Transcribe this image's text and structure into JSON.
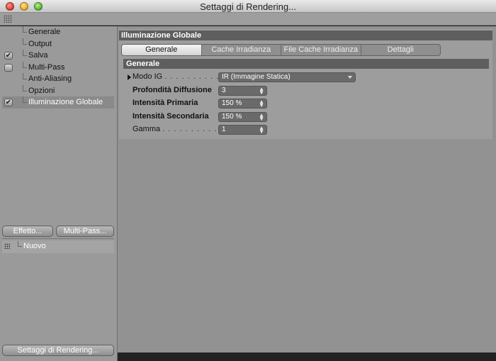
{
  "window": {
    "title": "Settaggi di Rendering..."
  },
  "sidebar": {
    "items": [
      {
        "label": "Generale",
        "checkbox": false,
        "checked": false
      },
      {
        "label": "Output",
        "checkbox": false,
        "checked": false
      },
      {
        "label": "Salva",
        "checkbox": true,
        "checked": true
      },
      {
        "label": "Multi-Pass",
        "checkbox": true,
        "checked": false
      },
      {
        "label": "Anti-Aliasing",
        "checkbox": false,
        "checked": false
      },
      {
        "label": "Opzioni",
        "checkbox": false,
        "checked": false
      },
      {
        "label": "Illuminazione Globale",
        "checkbox": true,
        "checked": true,
        "selected": true
      }
    ],
    "check_glyph": "✔",
    "effect_button": "Effetto...",
    "multipass_button": "Multi-Pass...",
    "new_item": "Nuovo",
    "render_settings_button": "Settaggi di Rendering..."
  },
  "main": {
    "section_title": "Illuminazione Globale",
    "tabs": [
      {
        "label": "Generale",
        "active": true
      },
      {
        "label": "Cache Irradianza",
        "active": false
      },
      {
        "label": "File Cache Irradianza",
        "active": false
      },
      {
        "label": "Dettagli",
        "active": false
      }
    ],
    "subsection_title": "Generale",
    "fields": {
      "modo_ig": {
        "label": "Modo IG",
        "dots": ". . . . . . . . . . . . .",
        "value": "IR (Immagine Statica)"
      },
      "profondita": {
        "label": "Profondità Diffusione",
        "value": "3"
      },
      "primaria": {
        "label": "Intensità Primaria",
        "value": "150 %"
      },
      "secondaria": {
        "label": "Intensità Secondaria",
        "value": "150 %"
      },
      "gamma": {
        "label": "Gamma",
        "dots": ". . . . . . . . . . . . . .",
        "value": "1"
      }
    }
  },
  "colors": {
    "panel": "#9a9a9a",
    "header": "#5e5e5e",
    "field": "#6a6a6a"
  }
}
